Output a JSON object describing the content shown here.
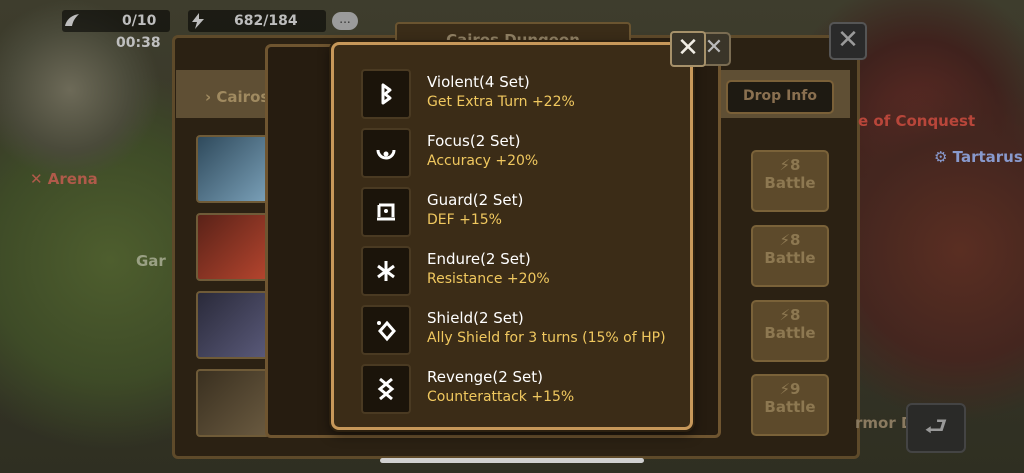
{
  "hud": {
    "wings": "0/10",
    "timer": "00:38",
    "energy": "682/184",
    "chat": "..."
  },
  "dungeon": {
    "title": "Cairos Dungeon",
    "crumb": "› Cairos",
    "drop_info": "Drop Info",
    "close": "✕"
  },
  "map_labels": {
    "arena": "Arena",
    "garden": "Gar",
    "conquest": "e of Conquest",
    "tartarus": "Tartarus",
    "armor": "rmor De"
  },
  "battles": [
    {
      "energy": "8",
      "label": "Battle"
    },
    {
      "energy": "8",
      "label": "Battle"
    },
    {
      "energy": "8",
      "label": "Battle"
    },
    {
      "energy": "9",
      "label": "Battle"
    }
  ],
  "popup": {
    "close": "✕",
    "sets": [
      {
        "name": "Violent(4 Set)",
        "effect": "Get Extra Turn +22%",
        "icon": "violent-rune-icon"
      },
      {
        "name": "Focus(2 Set)",
        "effect": "Accuracy +20%",
        "icon": "focus-rune-icon"
      },
      {
        "name": "Guard(2 Set)",
        "effect": "DEF +15%",
        "icon": "guard-rune-icon"
      },
      {
        "name": "Endure(2 Set)",
        "effect": "Resistance +20%",
        "icon": "endure-rune-icon"
      },
      {
        "name": "Shield(2 Set)",
        "effect": "Ally Shield for 3 turns (15% of HP)",
        "icon": "shield-rune-icon"
      },
      {
        "name": "Revenge(2 Set)",
        "effect": "Counterattack +15%",
        "icon": "revenge-rune-icon"
      }
    ]
  },
  "colors": {
    "popup_border": "#c7985a",
    "effect_text": "#f0c85f",
    "popup_bg": "#3b2c17"
  }
}
